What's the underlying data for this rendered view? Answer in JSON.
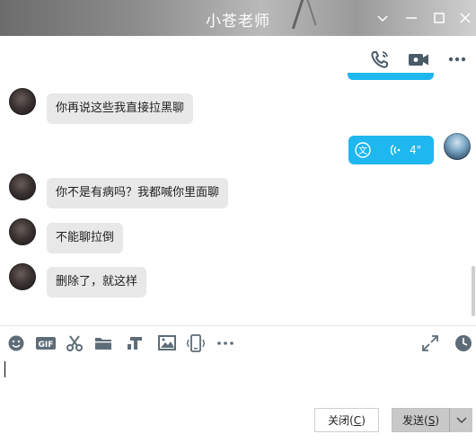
{
  "window": {
    "title": "小苍老师"
  },
  "messages": [
    {
      "side": "left",
      "text": "你再说这些我直接拉黑聊"
    },
    {
      "side": "right",
      "type": "voice",
      "duration": "4\""
    },
    {
      "side": "left",
      "text": "你不是有病吗？我都喊你里面聊"
    },
    {
      "side": "left",
      "text": "不能聊拉倒"
    },
    {
      "side": "left",
      "text": "删除了，就这样"
    }
  ],
  "toolbar": {
    "gif_label": "GIF",
    "tools": [
      "emoji-icon",
      "gif-icon",
      "scissors-icon",
      "folder-icon",
      "music-icon",
      "image-icon",
      "shake-icon",
      "more-icon",
      "expand-icon",
      "history-icon"
    ]
  },
  "buttons": {
    "close_label": "关闭(",
    "close_key": "C",
    "close_tail": ")",
    "send_label": "发送(",
    "send_key": "S",
    "send_tail": ")"
  },
  "colors": {
    "accent": "#1eb7ef",
    "bubble_gray": "#e8e8e8",
    "icon_gray": "#5d6c78"
  }
}
